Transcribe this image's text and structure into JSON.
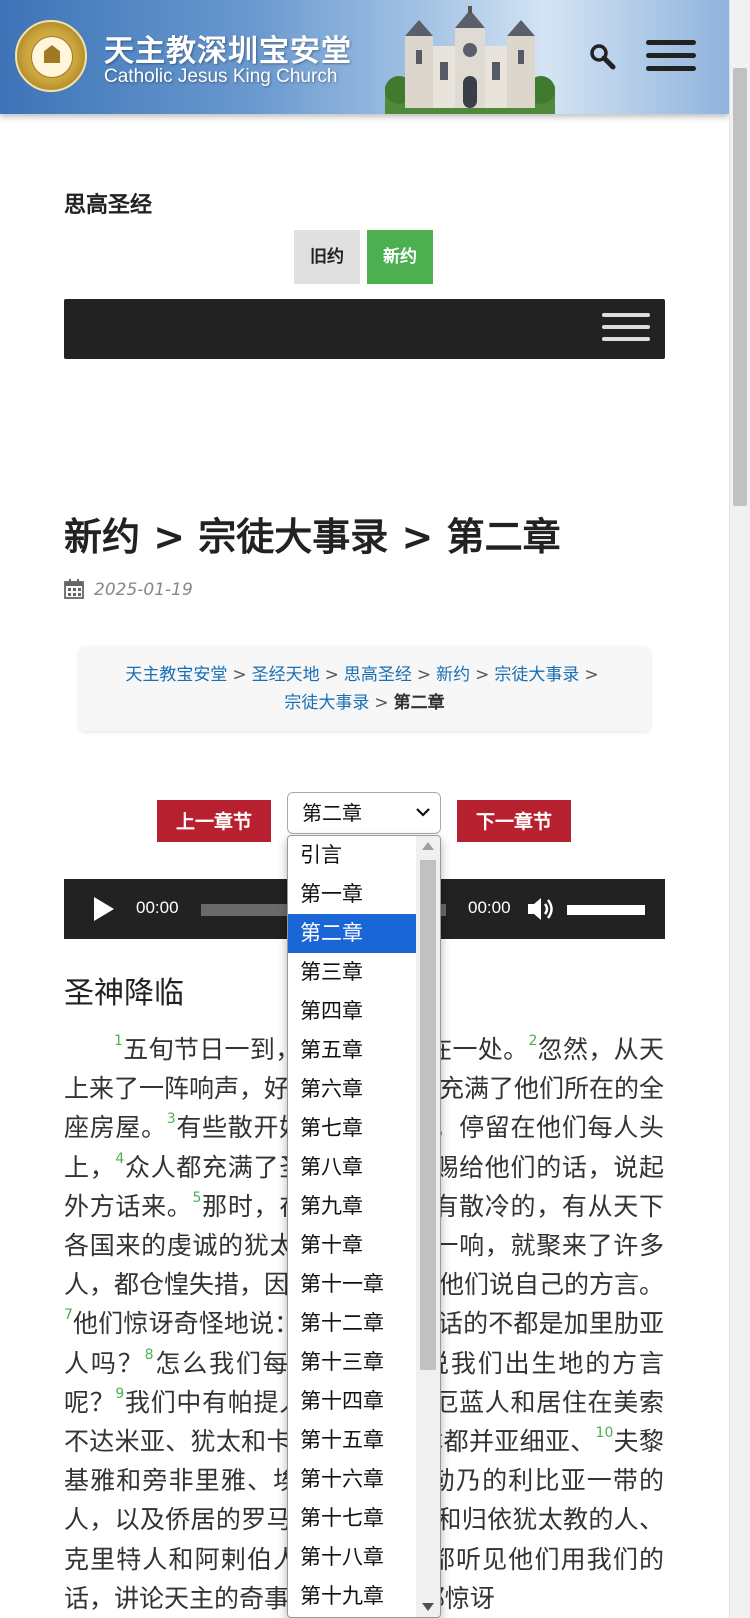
{
  "header": {
    "title_cn": "天主教深圳宝安堂",
    "title_en": "Catholic Jesus King Church"
  },
  "bible": {
    "name": "思高圣经",
    "old_testament": "旧约",
    "new_testament": "新约"
  },
  "page": {
    "title": "新约 > 宗徒大事录 > 第二章",
    "date": "2025-01-19"
  },
  "breadcrumb": {
    "items": [
      "天主教宝安堂",
      "圣经天地",
      "思高圣经",
      "新约",
      "宗徒大事录",
      "宗徒大事录"
    ],
    "current": "第二章"
  },
  "chapter_nav": {
    "prev": "上一章节",
    "next": "下一章节",
    "selected": "第二章",
    "options": [
      "引言",
      "第一章",
      "第二章",
      "第三章",
      "第四章",
      "第五章",
      "第六章",
      "第七章",
      "第八章",
      "第九章",
      "第十章",
      "第十一章",
      "第十二章",
      "第十三章",
      "第十四章",
      "第十五章",
      "第十六章",
      "第十七章",
      "第十八章",
      "第十九章"
    ]
  },
  "audio": {
    "current_time": "00:00",
    "total_time": "00:00",
    "progress": 0,
    "volume": 1.0
  },
  "content": {
    "section_heading": "圣神降临",
    "verses": [
      {
        "n": "1",
        "text": "五旬节日一到，他们都聚集在一处。"
      },
      {
        "n": "2",
        "text": "忽然，从天上来了一阵响声，好像暴风刮来，充满了他们所在的全座房屋。"
      },
      {
        "n": "3",
        "text": "有些散开好像火的舌头，停留在他们每人头上，"
      },
      {
        "n": "4",
        "text": "众人都充满了圣神，照圣神赐给他们的话，说起外方话来。"
      },
      {
        "n": "5",
        "text": "那时，在耶路撒冷住有散冷的，有从天下各国来的虔诚的犹太人。"
      },
      {
        "n": "6",
        "text": "这声音一响，就聚来了许多人，都仓惶失措，因为人人都听见他们说自己的方言。"
      },
      {
        "n": "7",
        "text": "他们惊讶奇怪地说：“看，这些说话的不都是加里肋亚人吗？"
      },
      {
        "n": "8",
        "text": "怎么我们每人听见他们说我们出生地的方言呢？"
      },
      {
        "n": "9",
        "text": "我们中有帕提人、玛待人、厄蓝人和居住在美索不达米亚、犹太和卡帕多细雅、本都并亚细亚、"
      },
      {
        "n": "10",
        "text": "夫黎基雅和旁非里雅、埃及并靠近基勒乃的利比亚一带的人，以及侨居的罗马人、"
      },
      {
        "n": "11",
        "text": "犹太人和归依犹太教的人、克里特人和阿剌伯人，怎么我们都听见他们用我们的话，讲论天主的奇事呢？”"
      },
      {
        "n": "12",
        "text": "众人都惊讶"
      }
    ]
  },
  "colors": {
    "testament_active": "#4caf50",
    "chapter_button": "#b7202e",
    "link": "#1a6fb3",
    "dropdown_selected": "#1a66d6",
    "dark_bar": "#222222"
  },
  "icons": {
    "search": "search-icon",
    "menu": "hamburger-menu-icon",
    "calendar": "calendar-icon",
    "play": "play-icon",
    "volume": "volume-icon"
  }
}
